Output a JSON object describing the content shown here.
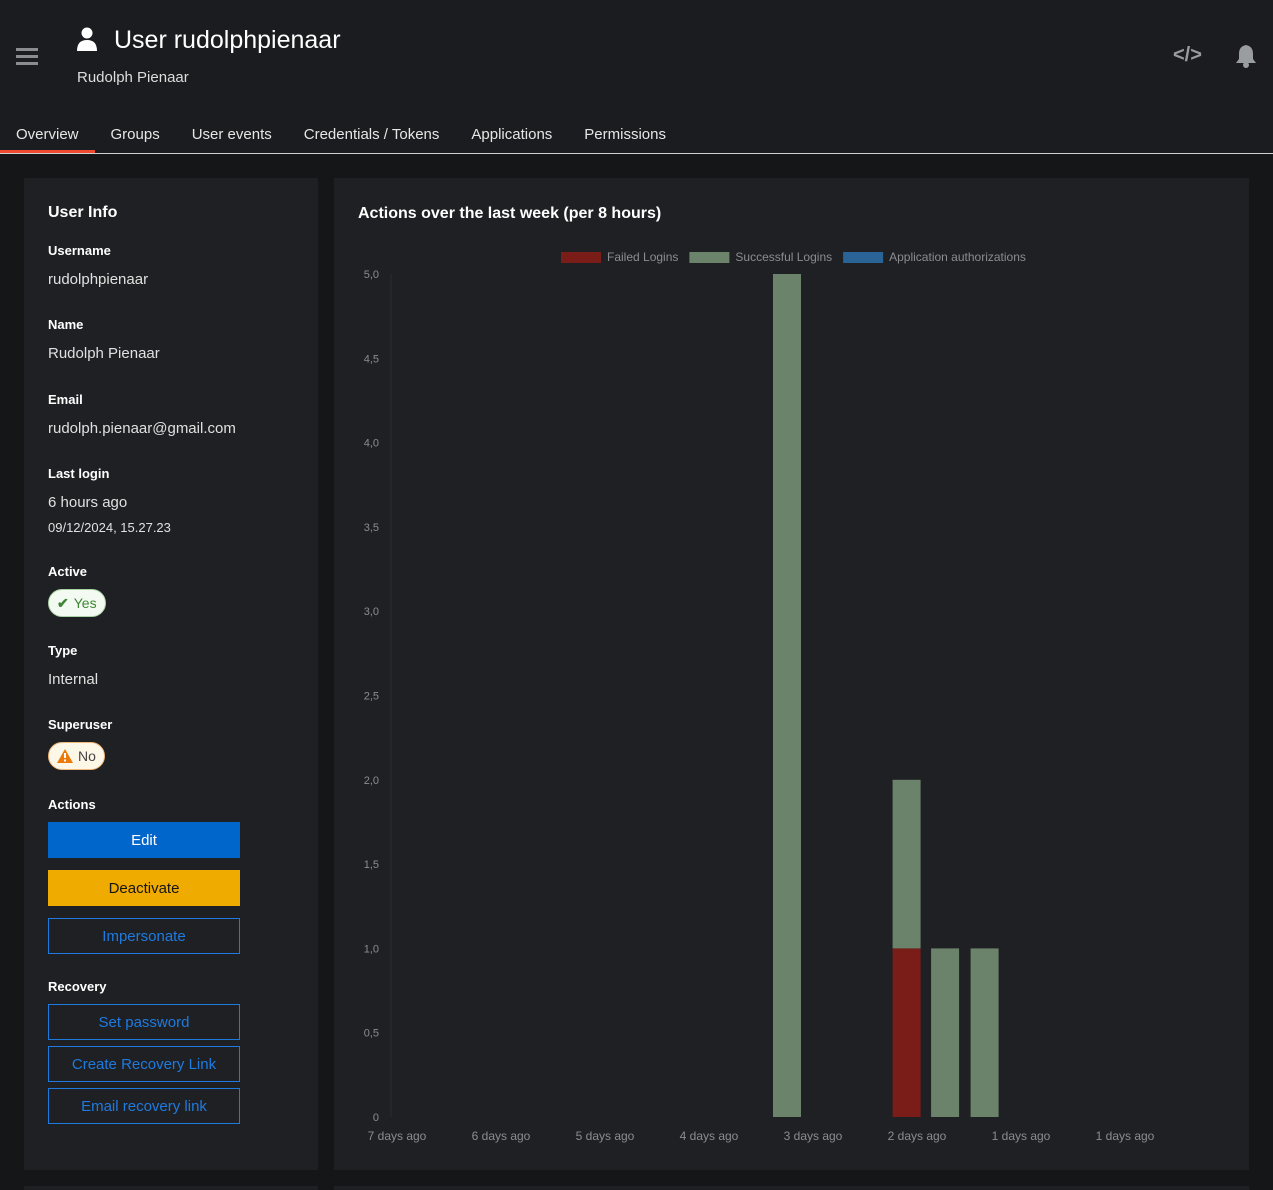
{
  "header": {
    "title": "User rudolphpienaar",
    "subtitle": "Rudolph Pienaar",
    "code_icon": "</>"
  },
  "tabs": [
    {
      "label": "Overview",
      "active": true
    },
    {
      "label": "Groups"
    },
    {
      "label": "User events"
    },
    {
      "label": "Credentials / Tokens"
    },
    {
      "label": "Applications"
    },
    {
      "label": "Permissions"
    }
  ],
  "user_info": {
    "title": "User Info",
    "username_label": "Username",
    "username": "rudolphpienaar",
    "name_label": "Name",
    "name": "Rudolph Pienaar",
    "email_label": "Email",
    "email": "rudolph.pienaar@gmail.com",
    "last_login_label": "Last login",
    "last_login_relative": "6 hours ago",
    "last_login_date": "09/12/2024, 15.27.23",
    "active_label": "Active",
    "active": "Yes",
    "type_label": "Type",
    "type": "Internal",
    "superuser_label": "Superuser",
    "superuser": "No",
    "actions_label": "Actions",
    "edit": "Edit",
    "deactivate": "Deactivate",
    "impersonate": "Impersonate",
    "recovery_label": "Recovery",
    "set_password": "Set password",
    "create_recovery_link": "Create Recovery Link",
    "email_recovery_link": "Email recovery link"
  },
  "chart_data": {
    "type": "bar",
    "title": "Actions over the last week (per 8 hours)",
    "legend": [
      {
        "name": "Failed Logins",
        "color": "#7a1c18"
      },
      {
        "name": "Successful Logins",
        "color": "#6b836b"
      },
      {
        "name": "Application authorizations",
        "color": "#2a6496"
      }
    ],
    "legend_position": "top",
    "x_ticks": [
      {
        "label": "7 days ago",
        "days_ago": 7
      },
      {
        "label": "6 days ago",
        "days_ago": 6
      },
      {
        "label": "5 days ago",
        "days_ago": 5
      },
      {
        "label": "4 days ago",
        "days_ago": 4
      },
      {
        "label": "3 days ago",
        "days_ago": 3
      },
      {
        "label": "2 days ago",
        "days_ago": 2
      },
      {
        "label": "1 days ago",
        "days_ago": 1
      },
      {
        "label": "1 days ago",
        "days_ago": 0
      }
    ],
    "y_ticks": [
      "0",
      "0,5",
      "1,0",
      "1,5",
      "2,0",
      "2,5",
      "3,0",
      "3,5",
      "4,0",
      "4,5",
      "5,0"
    ],
    "ylim": [
      0,
      5
    ],
    "bars": [
      {
        "days_ago": 3.25,
        "failed": 0,
        "successful": 5,
        "authorizations": 0
      },
      {
        "days_ago": 2.1,
        "failed": 1,
        "successful": 1,
        "authorizations": 0
      },
      {
        "days_ago": 1.73,
        "failed": 0,
        "successful": 1,
        "authorizations": 0
      },
      {
        "days_ago": 1.35,
        "failed": 0,
        "successful": 1,
        "authorizations": 0
      }
    ]
  }
}
